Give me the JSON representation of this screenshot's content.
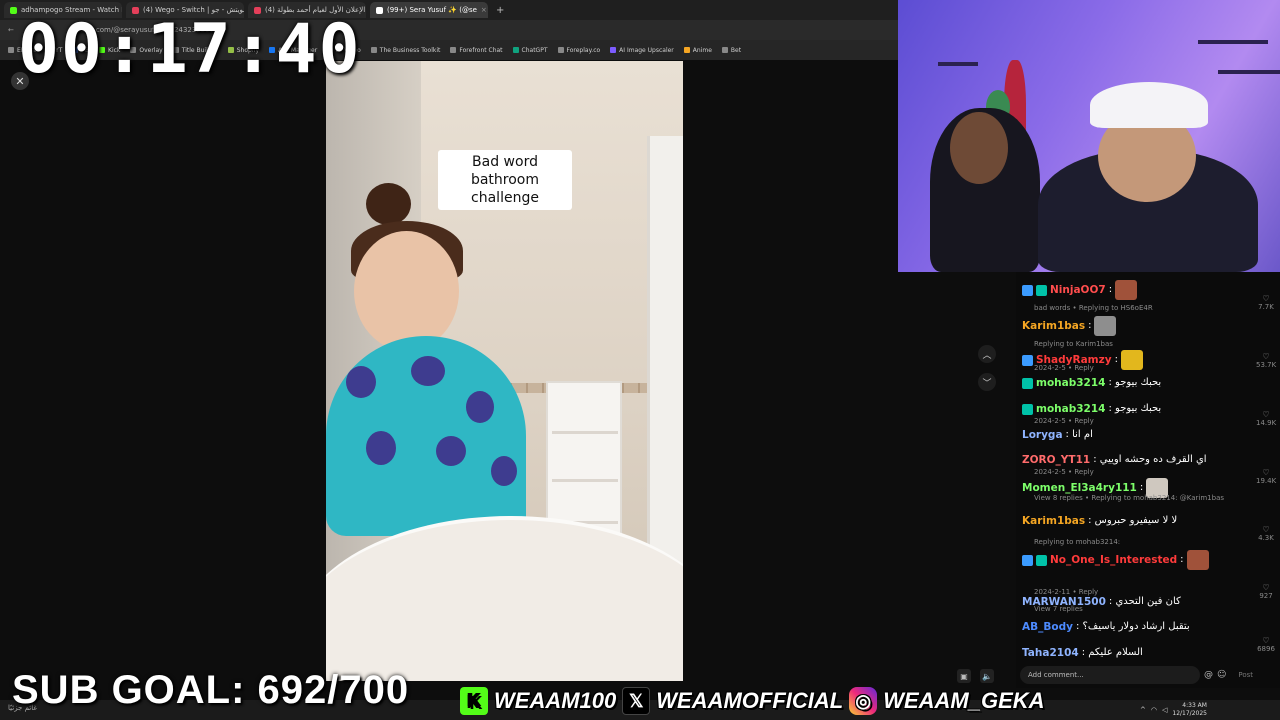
{
  "timer": "00:17:40",
  "sub_goal": "SUB GOAL: 692/700",
  "browser": {
    "tabs": [
      {
        "label": "adhampogo Stream - Watch Li",
        "color": "#53fc18"
      },
      {
        "label": "(4) Wego - Switch | سويتش - جو",
        "color": "#e43f5a"
      },
      {
        "label": "(4) الإعلان الأول لغيام أحمد بطولة",
        "color": "#e43f5a"
      },
      {
        "label": "(99+) Sera Yusuf ✨ (@se",
        "color": "#ffffff"
      }
    ],
    "new_tab": "+",
    "url": "tiktok.com/@serayusuf/vi...2243235597...4",
    "bookmarks": [
      "EEtest",
      "YT",
      "FB",
      "Kick",
      "Overlay",
      "Title Builder",
      "Shopify",
      "Ads Manager",
      "AI Video",
      "The Business Toolkit",
      "Forefront Chat",
      "ChatGPT",
      "Foreplay.co",
      "AI Image Upscaler",
      "Anime",
      "Bet"
    ]
  },
  "video": {
    "caption": "Bad word bathroom challenge"
  },
  "chat": {
    "messages": [
      {
        "user": "NinjaOO7",
        "color": "#ff4d4d",
        "text": ":",
        "sub": "bad words • Replying to HS6oE4R",
        "likes": "7.7K"
      },
      {
        "user": "Karim1bas",
        "color": "#f5a623",
        "text": ":",
        "sub": "Replying to Karim1bas",
        "likes": ""
      },
      {
        "user": "ShadyRamzy",
        "color": "#ff3b3b",
        "text": ":",
        "sub": "2024-2-5 • Reply",
        "likes": "53.7K"
      },
      {
        "user": "mohab3214",
        "color": "#7dff6a",
        "text": ": بحبك بيوجو",
        "sub": "",
        "likes": ""
      },
      {
        "user": "mohab3214",
        "color": "#7dff6a",
        "text": ": بحبك بيوجو",
        "sub": "2024-2-5 • Reply",
        "likes": "14.9K"
      },
      {
        "user": "Loryga",
        "color": "#8fb4ff",
        "text": ": ام انا",
        "sub": "",
        "likes": ""
      },
      {
        "user": "ZORO_YT11",
        "color": "#ff6b6b",
        "text": ": اي القرف ده وحشه اوييي",
        "sub": "2024-2-5 • Reply",
        "likes": "19.4K"
      },
      {
        "user": "Momen_El3a4ry111",
        "color": "#7dff6a",
        "text": ":",
        "sub": "View 8 replies • Replying to mohab3214: @Karim1bas",
        "likes": ""
      },
      {
        "user": "Karim1bas",
        "color": "#f5a623",
        "text": ": لا لا سيفيرو حبروس",
        "sub": "Replying to mohab3214:",
        "likes": "4.3K"
      },
      {
        "user": "No_One_Is_Interested",
        "color": "#ff3b3b",
        "text": ":",
        "sub": "2024-2-11 • Reply",
        "likes": "927"
      },
      {
        "user": "MARWAN1500",
        "color": "#8fb4ff",
        "text": ": كان فين التحدي",
        "sub": "View 7 replies",
        "likes": ""
      },
      {
        "user": "AB_Body",
        "color": "#4d8bff",
        "text": ": بتقبل ارشاد دولار ياسيف؟",
        "sub": "",
        "likes": "6896"
      },
      {
        "user": "Taha2104",
        "color": "#8fb4ff",
        "text": ": السلام عليكم",
        "sub": "",
        "likes": ""
      }
    ],
    "comment_placeholder": "Add comment...",
    "post_label": "Post"
  },
  "socials": {
    "kick": "WEAAM100",
    "x": "WEAAMOFFICIAL",
    "instagram": "WEAAM_GEKA"
  },
  "taskbar": {
    "weather": "غائم جزئيًا",
    "time": "4:33 AM",
    "date": "12/17/2025"
  }
}
